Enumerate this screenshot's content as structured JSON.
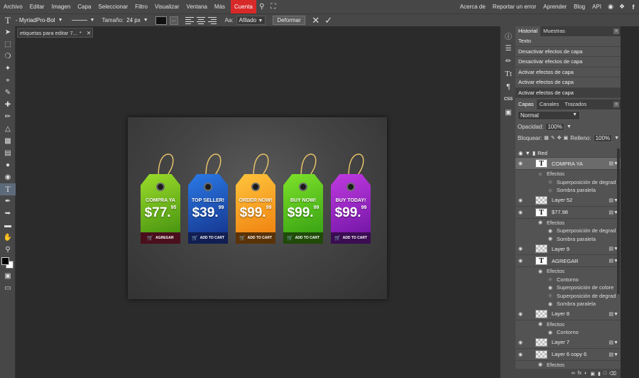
{
  "menubar": {
    "items": [
      "Archivo",
      "Editar",
      "Imagen",
      "Capa",
      "Seleccionar",
      "Filtro",
      "Visualizar",
      "Ventana",
      "Más"
    ],
    "highlight": "Cuenta",
    "right_items": [
      "Acerca de",
      "Reportar un error",
      "Aprender",
      "Blog",
      "API"
    ]
  },
  "options": {
    "font": "- MyriadPro-Bol",
    "size_label": "Tamaño:",
    "size_value": "24 px",
    "dots_label": "...",
    "aa_label": "Aa:",
    "aa_value": "Afilado",
    "warp_button": "Deformar"
  },
  "document": {
    "tab_title": "etiquetas para editar 7...",
    "tab_modified": "*",
    "tags": [
      {
        "label": "COMPRA YA",
        "price": "$77.",
        "cents": "95",
        "footer": "AGREGAR",
        "top": "#9bdc2a",
        "bottom": "#3c8a0d",
        "foot_bg": "#4a0f1c"
      },
      {
        "label": "TOP SELLER!",
        "price": "$39.",
        "cents": "99",
        "footer": "ADD TO CART",
        "top": "#2a7ae6",
        "bottom": "#142f86",
        "foot_bg": "#111e52"
      },
      {
        "label": "ORDER NOW!",
        "price": "$99.",
        "cents": "99",
        "footer": "ADD TO CART",
        "top": "#ffc43c",
        "bottom": "#ee7b0c",
        "foot_bg": "#5a3208"
      },
      {
        "label": "BUY NOW!",
        "price": "$99.",
        "cents": "99",
        "footer": "ADD TO CART",
        "top": "#7ee22a",
        "bottom": "#2f9a10",
        "foot_bg": "#1f4a08"
      },
      {
        "label": "BUY TODAY!",
        "price": "$99.",
        "cents": "99",
        "footer": "ADD TO CART",
        "top": "#c03ae0",
        "bottom": "#6a12a0",
        "foot_bg": "#3a0c52"
      }
    ]
  },
  "history": {
    "tabs": [
      "Historial",
      "Muestras"
    ],
    "items": [
      "Texto",
      "Desactivar efectos de capa",
      "Desactivar efectos de capa",
      "Activar efectos de capa",
      "Activar efectos de capa",
      "Activar efectos de capa"
    ]
  },
  "layers_panel": {
    "tabs": [
      "Capas",
      "Canales",
      "Trazados"
    ],
    "blend_mode": "Normal",
    "opacity_label": "Opacidad:",
    "opacity_value": "100%",
    "lock_label": "Bloquear:",
    "fill_label": "Relleno:",
    "fill_value": "100%",
    "group_name": "Red"
  },
  "layers": [
    {
      "type": "layer",
      "name": "COMPRA YA",
      "thumb": "text",
      "selected": true
    },
    {
      "type": "fx",
      "name": "Efectos",
      "indent": 1,
      "eye": false
    },
    {
      "type": "fx",
      "name": "Superposición de degrad",
      "indent": 2,
      "eye": false
    },
    {
      "type": "fx",
      "name": "Sombra paralela",
      "indent": 2,
      "eye": false
    },
    {
      "type": "layer",
      "name": "Layer 52",
      "thumb": "checker"
    },
    {
      "type": "layer",
      "name": "$77.98",
      "thumb": "text"
    },
    {
      "type": "fx",
      "name": "Efectos",
      "indent": 1,
      "eye": true
    },
    {
      "type": "fx",
      "name": "Superposición de degrad",
      "indent": 2,
      "eye": true
    },
    {
      "type": "fx",
      "name": "Sombra paralela",
      "indent": 2,
      "eye": true
    },
    {
      "type": "layer",
      "name": "Layer 9",
      "thumb": "checker"
    },
    {
      "type": "layer",
      "name": "AGREGAR",
      "thumb": "text"
    },
    {
      "type": "fx",
      "name": "Efectos",
      "indent": 1,
      "eye": true
    },
    {
      "type": "fx",
      "name": "Contorno",
      "indent": 2,
      "eye": false
    },
    {
      "type": "fx",
      "name": "Superposición de colore",
      "indent": 2,
      "eye": true
    },
    {
      "type": "fx",
      "name": "Superposición de degrad",
      "indent": 2,
      "eye": false
    },
    {
      "type": "fx",
      "name": "Sombra paralela",
      "indent": 2,
      "eye": true
    },
    {
      "type": "layer",
      "name": "Layer 8",
      "thumb": "checker"
    },
    {
      "type": "fx",
      "name": "Efectos",
      "indent": 1,
      "eye": true
    },
    {
      "type": "fx",
      "name": "Contorno",
      "indent": 2,
      "eye": true
    },
    {
      "type": "layer",
      "name": "Layer 7",
      "thumb": "checker"
    },
    {
      "type": "layer",
      "name": "Layer 6 copy 6",
      "thumb": "checker"
    },
    {
      "type": "fx",
      "name": "Efectos",
      "indent": 1,
      "eye": true
    }
  ]
}
